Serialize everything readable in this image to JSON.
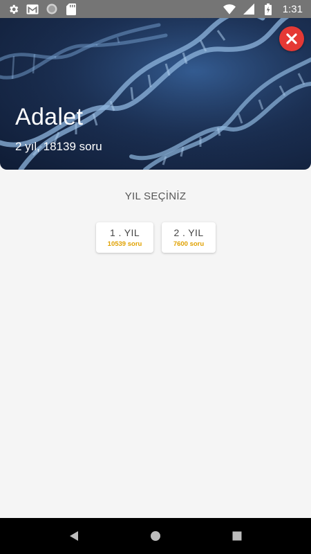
{
  "status_bar": {
    "time": "1:31",
    "icons": [
      "gear-icon",
      "gmail-icon",
      "circle-icon",
      "sd-card-icon",
      "wifi-icon",
      "signal-icon",
      "battery-icon"
    ]
  },
  "header": {
    "title": "Adalet",
    "subtitle": "2 yıl, 18139 soru"
  },
  "content": {
    "section_title": "YIL SEÇİNİZ",
    "years": [
      {
        "label": "1 . YIL",
        "count": "10539 soru"
      },
      {
        "label": "2 . YIL",
        "count": "7600 soru"
      }
    ]
  },
  "colors": {
    "accent_count": "#e0a100",
    "close_button": "#e53935",
    "status_bar": "#757575"
  }
}
